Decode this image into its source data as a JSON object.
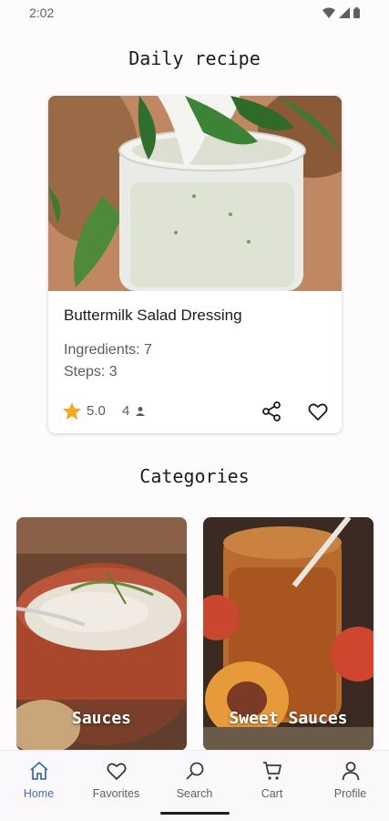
{
  "status_bar": {
    "time": "2:02",
    "icons": [
      "wifi-icon",
      "signal-icon",
      "battery-icon"
    ]
  },
  "daily": {
    "title": "Daily recipe",
    "recipe": {
      "name": "Buttermilk Salad Dressing",
      "ingredients": "Ingredients: 7",
      "steps": "Steps: 3",
      "rating": "5.0",
      "rating_count": "4"
    }
  },
  "categories": {
    "title": "Categories",
    "items": [
      {
        "label": "Sauces"
      },
      {
        "label": "Sweet Sauces"
      }
    ]
  },
  "nav": {
    "items": [
      {
        "label": "Home",
        "icon": "home-icon",
        "active": true
      },
      {
        "label": "Favorites",
        "icon": "heart-icon"
      },
      {
        "label": "Search",
        "icon": "search-icon"
      },
      {
        "label": "Cart",
        "icon": "cart-icon"
      },
      {
        "label": "Profile",
        "icon": "person-icon"
      }
    ]
  },
  "colors": {
    "accent": "#3f6fb8",
    "star": "#f5a623",
    "text": "#1c1b1f",
    "muted": "#5b5b5b"
  }
}
